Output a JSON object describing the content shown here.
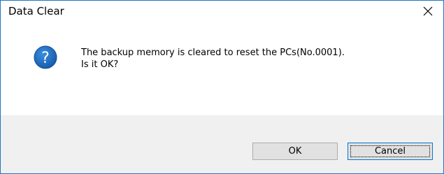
{
  "window": {
    "title": "Data Clear",
    "close_icon": "close-icon"
  },
  "message": {
    "icon": "question-icon",
    "line1": "The backup memory is cleared to reset the PCs(No.0001).",
    "line2": "Is it OK?"
  },
  "buttons": {
    "ok_label": "OK",
    "cancel_label": "Cancel"
  },
  "colors": {
    "border": "#1a79c4",
    "icon_blue": "#1e64b4",
    "footer_bg": "#f0f0f0",
    "button_bg": "#e1e1e1",
    "focus_border": "#0078d7"
  }
}
